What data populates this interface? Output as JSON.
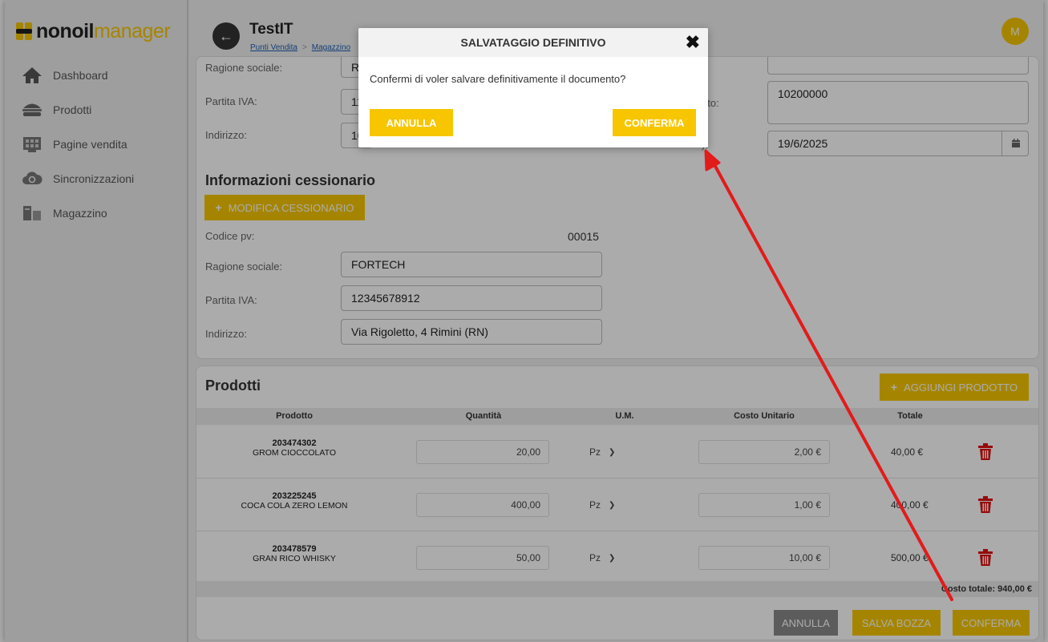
{
  "app": {
    "logo_part1": "nonoil",
    "logo_part2": "manager"
  },
  "sidebar": {
    "items": [
      {
        "label": "Dashboard",
        "icon": "home-icon"
      },
      {
        "label": "Prodotti",
        "icon": "burger-icon"
      },
      {
        "label": "Pagine vendita",
        "icon": "grid-icon"
      },
      {
        "label": "Sincronizzazioni",
        "icon": "cloud-sync-icon"
      },
      {
        "label": "Magazzino",
        "icon": "warehouse-icon"
      }
    ]
  },
  "header": {
    "title": "TestIT",
    "breadcrumb": [
      "Punti Vendita",
      "Magazzino"
    ],
    "avatar": "M"
  },
  "cedente": {
    "ragione_label": "Ragione sociale:",
    "ragione_value": "Re",
    "piva_label": "Partita IVA:",
    "piva_value": "11",
    "indirizzo_label": "Indirizzo:",
    "indirizzo_value": "10"
  },
  "documento": {
    "numero_label": "nto:",
    "numero_value": "10200000",
    "data_label": "):",
    "data_value": "19/6/2025"
  },
  "cessionario": {
    "title": "Informazioni cessionario",
    "modifica_label": "MODIFICA CESSIONARIO",
    "codice_label": "Codice pv:",
    "codice_value": "00015",
    "ragione_label": "Ragione sociale:",
    "ragione_value": "FORTECH",
    "piva_label": "Partita IVA:",
    "piva_value": "12345678912",
    "indirizzo_label": "Indirizzo:",
    "indirizzo_value": "Via Rigoletto, 4 Rimini (RN)"
  },
  "prodotti": {
    "title": "Prodotti",
    "add_label": "AGGIUNGI PRODOTTO",
    "columns": [
      "Prodotto",
      "Quantità",
      "U.M.",
      "Costo Unitario",
      "Totale"
    ],
    "rows": [
      {
        "code": "203474302",
        "name": "GROM CIOCCOLATO",
        "qty": "20,00",
        "um": "Pz",
        "cost": "2,00 €",
        "total": "40,00 €"
      },
      {
        "code": "203225245",
        "name": "COCA COLA ZERO LEMON",
        "qty": "400,00",
        "um": "Pz",
        "cost": "1,00 €",
        "total": "400,00 €"
      },
      {
        "code": "203478579",
        "name": "GRAN RICO WHISKY",
        "qty": "50,00",
        "um": "Pz",
        "cost": "10,00 €",
        "total": "500,00 €"
      }
    ],
    "costo_totale": "Costo totale: 940,00 €"
  },
  "footer_buttons": {
    "annulla": "ANNULLA",
    "salva_bozza": "SALVA BOZZA",
    "conferma": "CONFERMA"
  },
  "modal": {
    "title": "SALVATAGGIO DEFINITIVO",
    "message": "Confermi di voler salvare definitivamente il documento?",
    "annulla": "ANNULLA",
    "conferma": "CONFERMA"
  },
  "colors": {
    "accent": "#f7c600",
    "annotation_arrow": "#e21b1b",
    "delete": "#e01010",
    "annulla_gray": "#8a8a8a"
  }
}
